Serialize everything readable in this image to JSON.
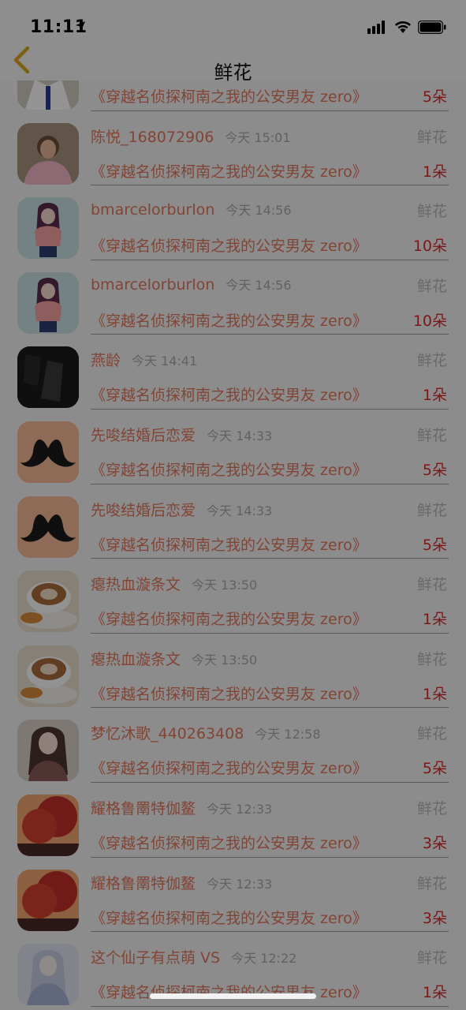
{
  "status_bar": {
    "time": "11:11"
  },
  "nav": {
    "title": "鲜花"
  },
  "book_title": "《穿越名侦探柯南之我的公安男友 zero》",
  "tag_label": "鲜花",
  "entries": [
    {
      "name": "",
      "time": "",
      "count": "5朵",
      "avatar": "person-icon"
    },
    {
      "name": "陈悦_168072906",
      "time": "今天 15:01",
      "count": "1朵",
      "avatar": "person-icon"
    },
    {
      "name": "bmarcelorburlon",
      "time": "今天 14:56",
      "count": "10朵",
      "avatar": "anime-girl-icon"
    },
    {
      "name": "bmarcelorburlon",
      "time": "今天 14:56",
      "count": "10朵",
      "avatar": "anime-girl-icon"
    },
    {
      "name": "燕龄",
      "time": "今天 14:41",
      "count": "1朵",
      "avatar": "dark-photo-icon"
    },
    {
      "name": "先唆结婚后恋爱",
      "time": "今天 14:33",
      "count": "5朵",
      "avatar": "mustache-icon"
    },
    {
      "name": "先唆结婚后恋爱",
      "time": "今天 14:33",
      "count": "5朵",
      "avatar": "mustache-icon"
    },
    {
      "name": "瘪热血漩条文",
      "time": "今天 13:50",
      "count": "1朵",
      "avatar": "coffee-icon"
    },
    {
      "name": "瘪热血漩条文",
      "time": "今天 13:50",
      "count": "1朵",
      "avatar": "coffee-icon"
    },
    {
      "name": "梦忆沐歌_440263408",
      "time": "今天 12:58",
      "count": "5朵",
      "avatar": "anime-girl-icon"
    },
    {
      "name": "耀格鲁罱特伽鳌",
      "time": "今天 12:33",
      "count": "3朵",
      "avatar": "tree-icon"
    },
    {
      "name": "耀格鲁罱特伽鳌",
      "time": "今天 12:33",
      "count": "3朵",
      "avatar": "tree-icon"
    },
    {
      "name": "这个仙子有点萌 VS",
      "time": "今天 12:22",
      "count": "1朵",
      "avatar": "fairy-icon"
    }
  ]
}
